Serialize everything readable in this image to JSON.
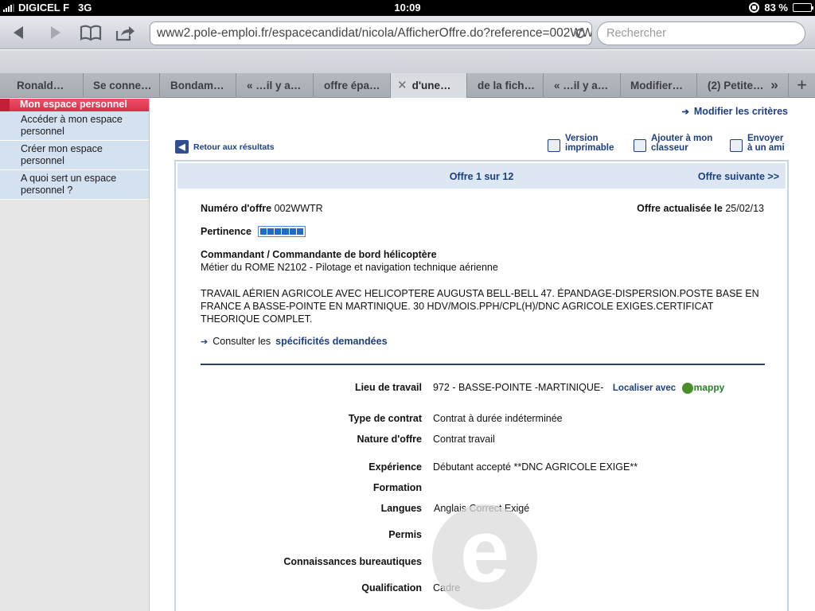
{
  "status": {
    "carrier": "DIGICEL F",
    "network": "3G",
    "time": "10:09",
    "battery": "83 %",
    "battery_level": 0.83
  },
  "browser": {
    "url": "www2.pole-emploi.fr/espacecandidat/nicola/AfficherOffre.do?reference=002WW",
    "search_placeholder": "Rechercher",
    "tabs": [
      {
        "label": "Ronald…",
        "active": false
      },
      {
        "label": "Se conne…",
        "active": false
      },
      {
        "label": "Bondam…",
        "active": false
      },
      {
        "label": "« …il y a…",
        "active": false
      },
      {
        "label": "offre épa…",
        "active": false
      },
      {
        "label": "d'une…",
        "active": true
      },
      {
        "label": "de la fich…",
        "active": false
      },
      {
        "label": "« …il y a…",
        "active": false
      },
      {
        "label": "Modifier…",
        "active": false
      },
      {
        "label": "(2) Petite…",
        "active": false
      }
    ],
    "tab_close": "✕",
    "tab_more": "»",
    "tab_add": "+"
  },
  "sidebar": {
    "header": "Mon espace personnel",
    "items": [
      "Accéder à mon espace personnel",
      "Créer mon espace personnel",
      "A quoi sert un espace personnel ?"
    ]
  },
  "page": {
    "modify_criteria": "Modifier les critères",
    "back_results": "Retour aux résultats",
    "actions": {
      "print": [
        "Version",
        "imprimable"
      ],
      "add": [
        "Ajouter à mon",
        "classeur"
      ],
      "send": [
        "Envoyer",
        "à un ami"
      ]
    },
    "offer_count": "Offre 1 sur 12",
    "next_offer": "Offre suivante >>",
    "offer_number_label": "Numéro d'offre",
    "offer_number": "002WWTR",
    "updated_label": "Offre actualisée le",
    "updated_date": "25/02/13",
    "pertinence_label": "Pertinence",
    "pertinence_level": 6,
    "job_title": "Commandant / Commandante de bord hélicoptère",
    "job_rome": "Métier du ROME N2102 - Pilotage et navigation technique aérienne",
    "description": "TRAVAIL AÉRIEN AGRICOLE AVEC HELICOPTERE AUGUSTA BELL-BELL 47. ÉPANDAGE-DISPERSION.POSTE BASE EN FRANCE A BASSE-POINTE EN MARTINIQUE. 30 HDV/MOIS.PPH/CPL(H)/DNC AGRICOLE EXIGES.CERTIFICAT THEORIQUE COMPLET.",
    "consult_prefix": "Consulter les",
    "consult_link": "spécificités demandées",
    "fields": {
      "lieu_label": "Lieu de travail",
      "lieu_value": "972 - BASSE-POINTE -MARTINIQUE-",
      "mappy_link": "Localiser avec",
      "mappy_logo": "mappy",
      "contrat_label": "Type de contrat",
      "contrat_value": "Contrat à durée indéterminée",
      "nature_label": "Nature d'offre",
      "nature_value": "Contrat travail",
      "experience_label": "Expérience",
      "experience_value": "Débutant accepté **DNC AGRICOLE EXIGE**",
      "formation_label": "Formation",
      "langues_label": "Langues",
      "langues_value": "Anglais Correct Exigé",
      "permis_label": "Permis",
      "bureautique_label": "Connaissances bureautiques",
      "qualification_label": "Qualification",
      "qualification_value": "Cadre"
    },
    "watermark": "e"
  }
}
